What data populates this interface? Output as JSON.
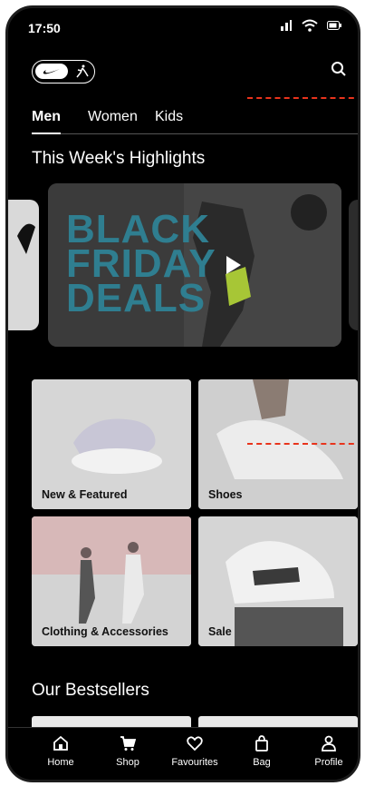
{
  "status": {
    "time": "17:50"
  },
  "tabs": [
    {
      "label": "Men",
      "active": true
    },
    {
      "label": "Women",
      "active": false
    },
    {
      "label": "Kids",
      "active": false
    }
  ],
  "highlights": {
    "title": "This Week's Highlights",
    "promo_text": [
      "BLACK",
      "FRIDAY",
      "DEALS"
    ]
  },
  "categories": [
    {
      "label": "New & Featured"
    },
    {
      "label": "Shoes"
    },
    {
      "label": "Clothing & Accessories"
    },
    {
      "label": "Sale"
    }
  ],
  "bestsellers": {
    "title": "Our Bestsellers"
  },
  "nav": [
    {
      "label": "Home",
      "icon": "home-icon"
    },
    {
      "label": "Shop",
      "icon": "cart-icon"
    },
    {
      "label": "Favourites",
      "icon": "heart-icon"
    },
    {
      "label": "Bag",
      "icon": "bag-icon"
    },
    {
      "label": "Profile",
      "icon": "profile-icon"
    }
  ],
  "colors": {
    "background": "#000000",
    "promo_text": "#2f7e90",
    "annotation": "#e8341c"
  }
}
